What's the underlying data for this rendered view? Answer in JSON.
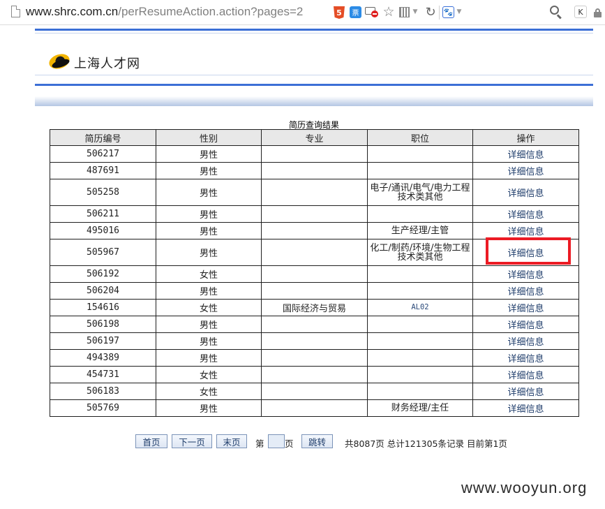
{
  "browser": {
    "url_host": "www.shrc.com.cn",
    "url_path": "/perResumeAction.action?pages=2",
    "icons": [
      "page-icon",
      "html5-icon",
      "ticket-icon",
      "adblock-icon",
      "star-icon",
      "qr-icon",
      "reload-icon",
      "paw-icon",
      "search-icon",
      "k-extension-icon",
      "lock-icon"
    ],
    "html5_glyph": "5",
    "ticket_glyph": "票",
    "k_glyph": "K"
  },
  "site": {
    "name": "上海人才网"
  },
  "table": {
    "caption": "简历查询结果",
    "headers": [
      "简历编号",
      "性别",
      "专业",
      "职位",
      "操作"
    ],
    "rows": [
      {
        "id": "506217",
        "gender": "男性",
        "major": "",
        "position": "",
        "action": "详细信息"
      },
      {
        "id": "487691",
        "gender": "男性",
        "major": "",
        "position": "",
        "action": "详细信息"
      },
      {
        "id": "505258",
        "gender": "男性",
        "major": "",
        "position": "电子/通讯/电气/电力工程技术类其他",
        "action": "详细信息"
      },
      {
        "id": "506211",
        "gender": "男性",
        "major": "",
        "position": "",
        "action": "详细信息"
      },
      {
        "id": "495016",
        "gender": "男性",
        "major": "",
        "position": "生产经理/主管",
        "action": "详细信息"
      },
      {
        "id": "505967",
        "gender": "男性",
        "major": "",
        "position": "化工/制药/环境/生物工程技术类其他",
        "action": "详细信息"
      },
      {
        "id": "506192",
        "gender": "女性",
        "major": "",
        "position": "",
        "action": "详细信息"
      },
      {
        "id": "506204",
        "gender": "男性",
        "major": "",
        "position": "",
        "action": "详细信息"
      },
      {
        "id": "154616",
        "gender": "女性",
        "major": "国际经济与贸易",
        "position": "AL02",
        "action": "详细信息"
      },
      {
        "id": "506198",
        "gender": "男性",
        "major": "",
        "position": "",
        "action": "详细信息"
      },
      {
        "id": "506197",
        "gender": "男性",
        "major": "",
        "position": "",
        "action": "详细信息"
      },
      {
        "id": "494389",
        "gender": "男性",
        "major": "",
        "position": "",
        "action": "详细信息"
      },
      {
        "id": "454731",
        "gender": "女性",
        "major": "",
        "position": "",
        "action": "详细信息"
      },
      {
        "id": "506183",
        "gender": "女性",
        "major": "",
        "position": "",
        "action": "详细信息"
      },
      {
        "id": "505769",
        "gender": "男性",
        "major": "",
        "position": "财务经理/主任",
        "action": "详细信息"
      }
    ]
  },
  "pagination": {
    "first": "首页",
    "next": "下一页",
    "last": "末页",
    "page_prefix": "第",
    "page_input_value": "",
    "page_suffix": "页",
    "jump": "跳转",
    "summary": "共8087页 总计121305条记录 目前第1页"
  },
  "annotation": {
    "highlight_color": "#ec1b24"
  },
  "watermark": "www.wooyun.org",
  "colors": {
    "accent_blue": "#3c6fd6",
    "link": "#1f3d6b"
  }
}
